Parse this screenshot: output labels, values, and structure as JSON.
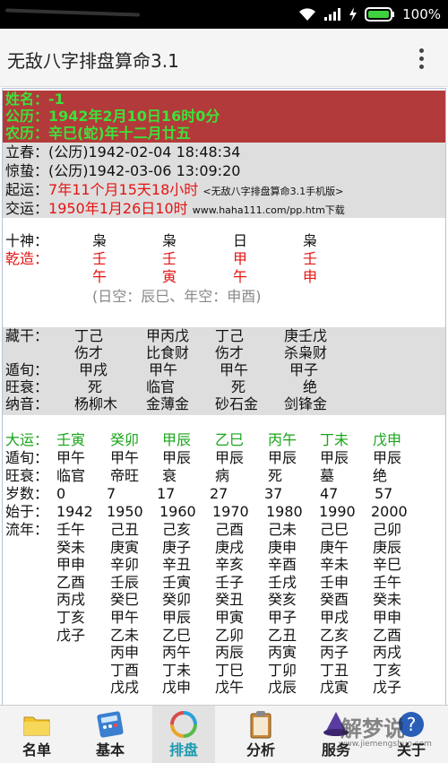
{
  "status_bar": {
    "battery": "100%"
  },
  "app_bar": {
    "title": "无敌八字排盘算命3.1"
  },
  "header": {
    "name": "姓名：-1",
    "solar": "公历：1942年2月10日16时0分",
    "lunar": "农历：辛巳(蛇)年十二月廿五"
  },
  "info": {
    "lichun_label": "立春：",
    "lichun_value": "(公历)1942-02-04 18:48:34",
    "jingzhe_label": "惊蛰：",
    "jingzhe_value": "(公历)1942-03-06 13:09:20",
    "qiyun_label": "起运：",
    "qiyun_value": "7年11个月15天18小时",
    "qiyun_note": "<无敌八字排盘算命3.1手机版>",
    "jiaoyun_label": "交运：",
    "jiaoyun_value": "1950年1月26日10时",
    "jiaoyun_note": "www.haha111.com/pp.htm下载"
  },
  "pillars": {
    "shishen_label": "十神：",
    "shishen": [
      "枭",
      "枭",
      "日",
      "枭"
    ],
    "qianzao_label": "乾造：",
    "stems": [
      "壬",
      "壬",
      "甲",
      "壬"
    ],
    "branches": [
      "午",
      "寅",
      "午",
      "申"
    ],
    "kongwang": "(日空：辰巳、年空：申酉)"
  },
  "details": {
    "canggan_label": "藏干：",
    "canggan": [
      "丁己",
      "甲丙戊",
      "丁己",
      "庚壬戊"
    ],
    "canggan_god": [
      "伤才",
      "比食财",
      "伤才",
      "杀枭财"
    ],
    "dunxun_label": "遁旬：",
    "dunxun": [
      "甲戌",
      "甲午",
      "甲午",
      "甲子"
    ],
    "wangshuai_label": "旺衰：",
    "wangshuai": [
      "死",
      "临官",
      "死",
      "绝"
    ],
    "nayin_label": "纳音：",
    "nayin": [
      "杨柳木",
      "金薄金",
      "砂石金",
      "剑锋金"
    ]
  },
  "dayun": {
    "dayun_label": "大运：",
    "dayun": [
      "壬寅",
      "癸卯",
      "甲辰",
      "乙巳",
      "丙午",
      "丁未",
      "戊申"
    ],
    "dunxun_label": "遁旬：",
    "dunxun": [
      "甲午",
      "甲午",
      "甲辰",
      "甲辰",
      "甲辰",
      "甲辰",
      "甲辰"
    ],
    "wangshuai_label": "旺衰：",
    "wangshuai": [
      "临官",
      "帝旺",
      "衰",
      "病",
      "死",
      "墓",
      "绝"
    ],
    "suishu_label": "岁数：",
    "suishu": [
      "0",
      "7",
      "17",
      "27",
      "37",
      "47",
      "57"
    ],
    "shiyu_label": "始于：",
    "shiyu": [
      "1942",
      "1950",
      "1960",
      "1970",
      "1980",
      "1990",
      "2000"
    ],
    "liunian_label": "流年：",
    "liunian": [
      [
        "壬午",
        "己丑",
        "己亥",
        "己酉",
        "己未",
        "己巳",
        "己卯"
      ],
      [
        "癸未",
        "庚寅",
        "庚子",
        "庚戌",
        "庚申",
        "庚午",
        "庚辰"
      ],
      [
        "甲申",
        "辛卯",
        "辛丑",
        "辛亥",
        "辛酉",
        "辛未",
        "辛巳"
      ],
      [
        "乙酉",
        "壬辰",
        "壬寅",
        "壬子",
        "壬戌",
        "壬申",
        "壬午"
      ],
      [
        "丙戌",
        "癸巳",
        "癸卯",
        "癸丑",
        "癸亥",
        "癸酉",
        "癸未"
      ],
      [
        "丁亥",
        "甲午",
        "甲辰",
        "甲寅",
        "甲子",
        "甲戌",
        "甲申"
      ],
      [
        "戊子",
        "乙未",
        "乙巳",
        "乙卯",
        "乙丑",
        "乙亥",
        "乙酉"
      ],
      [
        "",
        "丙申",
        "丙午",
        "丙辰",
        "丙寅",
        "丙子",
        "丙戌"
      ],
      [
        "",
        "丁酉",
        "丁未",
        "丁巳",
        "丁卯",
        "丁丑",
        "丁亥"
      ],
      [
        "",
        "戊戌",
        "戊申",
        "戊午",
        "戊辰",
        "戊寅",
        "戊子"
      ]
    ]
  },
  "tabs": {
    "mingdan": "名单",
    "jiben": "基本",
    "paipan": "排盘",
    "fenxi": "分析",
    "fuwu": "服务",
    "guanyu": "关于"
  },
  "watermark": {
    "text": "解梦说",
    "url": "www.jiemengshuo.com"
  },
  "colors": {
    "header_bg": "#b33a3a",
    "header_text": "#3be23b",
    "highlight_red": "#e31414",
    "dayun_green": "#1aa51a",
    "active_tab": "#1a9ab0"
  }
}
